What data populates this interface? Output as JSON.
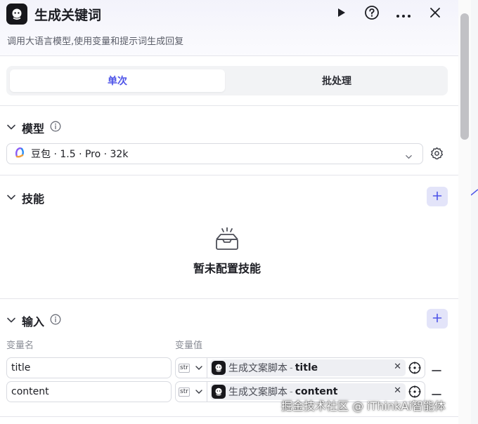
{
  "header": {
    "title": "生成关键词",
    "subtitle": "调用大语言模型,使用变量和提示词生成回复"
  },
  "tabs": [
    {
      "label": "单次",
      "active": true
    },
    {
      "label": "批处理",
      "active": false
    }
  ],
  "model_section": {
    "title": "模型",
    "selected_model": "豆包 · 1.5 · Pro · 32k"
  },
  "skills_section": {
    "title": "技能",
    "empty_text": "暂未配置技能"
  },
  "input_section": {
    "title": "输入",
    "col_name": "变量名",
    "col_value": "变量值",
    "rows": [
      {
        "name": "title",
        "type": "str",
        "ref_node": "生成文案脚本",
        "ref_sep": "-",
        "ref_field": "title"
      },
      {
        "name": "content",
        "type": "str",
        "ref_node": "生成文案脚本",
        "ref_sep": "-",
        "ref_field": "content"
      }
    ]
  },
  "watermark": "掘金技术社区 @ iThinkAi智能体",
  "colors": {
    "accent": "#4d53e8",
    "accent_bg": "#e3e4f9",
    "border": "#d9dbe1"
  }
}
